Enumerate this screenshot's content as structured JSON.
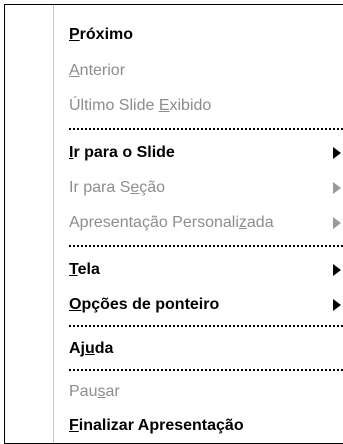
{
  "menu": {
    "items": [
      {
        "pre": "",
        "key": "P",
        "post": "róximo"
      },
      {
        "pre": "",
        "key": "A",
        "post": "nterior"
      },
      {
        "pre": "Último Slide ",
        "key": "E",
        "post": "xibido"
      },
      {
        "pre": "",
        "key": "I",
        "post": "r para o Slide"
      },
      {
        "pre": "Ir para S",
        "key": "e",
        "post": "ção"
      },
      {
        "pre": "Apresentação Personali",
        "key": "z",
        "post": "ada"
      },
      {
        "pre": "",
        "key": "T",
        "post": "ela"
      },
      {
        "pre": "",
        "key": "O",
        "post": "pções de ponteiro"
      },
      {
        "pre": "Aj",
        "key": "u",
        "post": "da"
      },
      {
        "pre": "Pau",
        "key": "s",
        "post": "ar"
      },
      {
        "pre": "",
        "key": "F",
        "post": "inalizar Apresentação"
      }
    ]
  }
}
